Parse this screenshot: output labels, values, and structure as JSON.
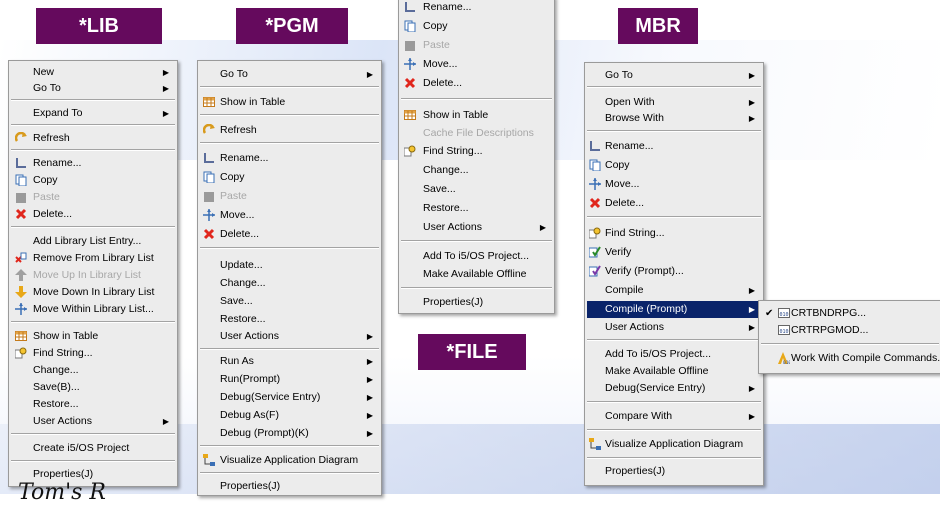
{
  "tags": {
    "lib": "*LIB",
    "pgm": "*PGM",
    "mbr": "MBR",
    "file": "*FILE"
  },
  "lib_menu": {
    "items": {
      "new": "New",
      "go_to": "Go To",
      "expand_to": "Expand To",
      "refresh": "Refresh",
      "rename": "Rename...",
      "copy": "Copy",
      "paste": "Paste",
      "delete": "Delete...",
      "add_liblist": "Add Library List Entry...",
      "remove_liblist": "Remove From Library List",
      "move_up": "Move Up In Library List",
      "move_down": "Move Down In Library List",
      "move_within": "Move Within Library List...",
      "show_table": "Show in Table",
      "find_string": "Find String...",
      "change": "Change...",
      "save": "Save(B)...",
      "restore": "Restore...",
      "user_actions": "User Actions",
      "create_project": "Create i5/OS Project",
      "properties": "Properties(J)"
    }
  },
  "pgm_menu": {
    "items": {
      "go_to": "Go To",
      "show_table": "Show in Table",
      "refresh": "Refresh",
      "rename": "Rename...",
      "copy": "Copy",
      "paste": "Paste",
      "move": "Move...",
      "delete": "Delete...",
      "update": "Update...",
      "change": "Change...",
      "save": "Save...",
      "restore": "Restore...",
      "user_actions": "User Actions",
      "run_as": "Run As",
      "run_prompt": "Run(Prompt)",
      "debug_entry": "Debug(Service Entry)",
      "debug_as": "Debug As(F)",
      "debug_prompt": "Debug (Prompt)(K)",
      "visualize": "Visualize Application Diagram",
      "properties": "Properties(J)"
    }
  },
  "file_menu": {
    "items": {
      "rename": "Rename...",
      "copy": "Copy",
      "paste": "Paste",
      "move": "Move...",
      "delete": "Delete...",
      "show_table": "Show in Table",
      "cache": "Cache File Descriptions",
      "find_string": "Find String...",
      "change": "Change...",
      "save": "Save...",
      "restore": "Restore...",
      "user_actions": "User Actions",
      "add_project": "Add To i5/OS Project...",
      "offline": "Make Available Offline",
      "properties": "Properties(J)"
    }
  },
  "mbr_menu": {
    "items": {
      "go_to": "Go To",
      "open_with": "Open With",
      "browse_with": "Browse With",
      "rename": "Rename...",
      "copy": "Copy",
      "move": "Move...",
      "delete": "Delete...",
      "find_string": "Find String...",
      "verify": "Verify",
      "verify_prompt": "Verify (Prompt)...",
      "compile": "Compile",
      "compile_prompt": "Compile (Prompt)",
      "user_actions": "User Actions",
      "add_project": "Add To i5/OS Project...",
      "offline": "Make Available Offline",
      "debug_entry": "Debug(Service Entry)",
      "compare_with": "Compare With",
      "visualize": "Visualize Application Diagram",
      "properties": "Properties(J)"
    }
  },
  "compile_submenu": {
    "items": {
      "crtbndrpg": "CRTBNDRPG...",
      "crtrpgmod": "CRTRPGMOD...",
      "work_with": "Work With Compile Commands..."
    }
  },
  "signature": "Tom's R"
}
